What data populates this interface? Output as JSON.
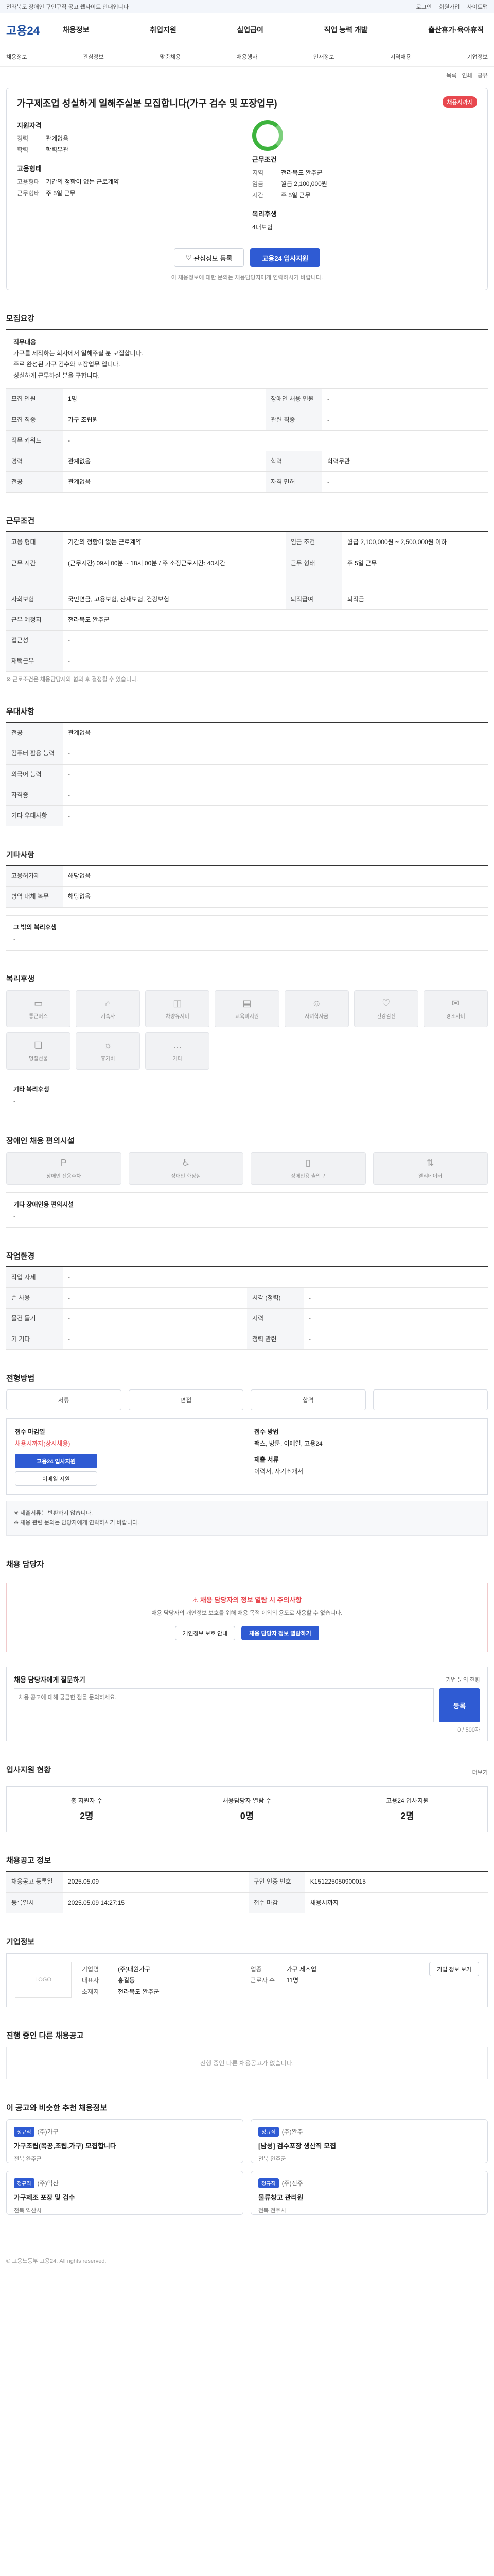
{
  "topbar": {
    "text": "전라북도 장애인 구인구직 공고 웹사이트 안내입니다",
    "links": [
      "로그인",
      "회원가입",
      "사이트맵"
    ]
  },
  "header": {
    "logo": "고용24",
    "nav": [
      "채용정보",
      "취업지원",
      "실업급여",
      "직업 능력 개발",
      "출산휴가·육아휴직"
    ]
  },
  "subnav": [
    "채용정보",
    "관심정보",
    "맞춤채용",
    "채용행사",
    "인재정보",
    "지역채용",
    "기업정보"
  ],
  "util": [
    "목록",
    "인쇄",
    "공유"
  ],
  "job": {
    "title": "가구제조업 성실하게 일해주실분 모집합니다(가구 검수 및 포장업무)",
    "badge": "채용시까지",
    "company_h": "지원자격",
    "company": [
      [
        "경력",
        "관계없음"
      ],
      [
        "학력",
        "학력무관"
      ]
    ],
    "cond_h": "근무조건",
    "cond": [
      [
        "지역",
        "전라북도 완주군"
      ],
      [
        "임금",
        "월급 2,100,000원"
      ],
      [
        "시간",
        "주 5일 근무"
      ]
    ],
    "type_h": "고용형태",
    "type": [
      [
        "고용형태",
        "기간의 정함이 없는 근로계약"
      ],
      [
        "근무형태",
        "주 5일 근무"
      ]
    ],
    "welfare_h": "복리후생",
    "welfare": "4대보험",
    "btn_scrap": "관심정보 등록",
    "btn_apply": "고용24 입사지원",
    "note": "이 채용정보에 대한 문의는 채용담당자에게 연락하시기 바랍니다."
  },
  "recruit": {
    "h": "모집요강",
    "desc": [
      "직무내용",
      "가구를 제작하는 회사에서 일해주실 분 모집합니다.",
      "주로 완성된 가구 검수와 포장업무 입니다.",
      "",
      "성실하게 근무하실 분을 구합니다."
    ],
    "rows": [
      [
        "모집 인원",
        "1명",
        "장애인 채용 인원",
        "-"
      ],
      [
        "모집 직종",
        "가구 조립원",
        "관련 직종",
        "-"
      ],
      [
        "직무 키워드",
        "-",
        "",
        ""
      ],
      [
        "경력",
        "관계없음",
        "학력",
        "학력무관"
      ],
      [
        "전공",
        "관계없음",
        "자격 면허",
        "-"
      ]
    ]
  },
  "work": {
    "h": "근무조건",
    "rows": [
      [
        "고용 형태",
        "기간의 정함이 없는 근로계약",
        "임금 조건",
        "월급 2,100,000원 ~ 2,500,000원 이하"
      ],
      [
        "근무 시간",
        "(근무시간) 09시 00분 ~ 18시 00분 / 주 소정근로시간: 40시간",
        "근무 형태",
        "주 5일 근무"
      ],
      [
        "사회보험",
        "국민연금, 고용보험, 산재보험, 건강보험",
        "퇴직급여",
        "퇴직금"
      ],
      [
        "근무 예정지",
        "전라북도 완주군",
        "",
        ""
      ],
      [
        "접근성",
        "-",
        "",
        ""
      ],
      [
        "재택근무",
        "-",
        "",
        ""
      ]
    ],
    "footnote": "※ 근로조건은 채용담당자와 협의 후 결정될 수 있습니다."
  },
  "special": {
    "h": "우대사항",
    "rows": [
      [
        "전공",
        "관계없음"
      ],
      [
        "컴퓨터 활용 능력",
        "-"
      ],
      [
        "외국어 능력",
        "-"
      ],
      [
        "자격증",
        "-"
      ],
      [
        "기타 우대사항",
        "-"
      ]
    ]
  },
  "etc": {
    "h": "기타사항",
    "rows": [
      [
        "고용허가제",
        "해당없음"
      ],
      [
        "병역 대체 복무",
        "해당없음"
      ]
    ],
    "extra_h": "그 밖의 복리후생",
    "extra": "-"
  },
  "welfare": {
    "h": "복리후생",
    "tiles": [
      "통근버스",
      "기숙사",
      "차량유지비",
      "교육비지원",
      "자녀학자금",
      "건강검진",
      "경조사비",
      "명절선물",
      "휴가비",
      "기타"
    ],
    "extra_h": "기타 복리후생",
    "extra": "-"
  },
  "disability": {
    "h": "장애인 채용 편의시설",
    "tiles": [
      "장애인 전용주차",
      "장애인 화장실",
      "장애인용 출입구",
      "엘리베이터"
    ],
    "extra_h": "기타 장애인용 편의시설",
    "extra": "-"
  },
  "workenv": {
    "h": "작업환경",
    "rows": [
      [
        "작업 자세",
        "-",
        "",
        ""
      ],
      [
        "손 사용",
        "-",
        "시각 (청력)",
        "-"
      ],
      [
        "물건 들기",
        "-",
        "시력",
        "-"
      ],
      [
        "기 기타",
        "-",
        "청력 관련",
        "-"
      ]
    ]
  },
  "process": {
    "h": "전형방법",
    "steps": [
      "서류",
      "면접",
      "합격",
      ""
    ],
    "deadline_h": "접수 마감일",
    "deadline": "채용시까지(상시채용)",
    "btn_apply": "고용24 입사지원",
    "btn_email": "이메일 지원",
    "method_h": "접수 방법",
    "method": "팩스, 방문, 이메일, 고용24",
    "doc_h": "제출 서류",
    "doc": "이력서, 자기소개서",
    "notes": [
      "※ 제출서류는 반환하지 않습니다.",
      "※ 채용 관련 문의는 담당자에게 연락하시기 바랍니다."
    ]
  },
  "contact": {
    "h": "채용 담당자",
    "warn": "채용 담당자의 정보 열람 시 주의사항",
    "warn_text": "채용 담당자의 개인정보 보호를 위해 채용 목적 이외의 용도로 사용할 수 없습니다.",
    "btn1": "개인정보 보호 안내",
    "btn2": "채용 담당자 정보 열람하기"
  },
  "inquiry": {
    "h": "채용 담당자에게 질문하기",
    "link": "기업 문의 현황",
    "placeholder": "채용 공고에 대해 궁금한 점을 문의하세요.",
    "btn": "등록",
    "count": "0 / 500자"
  },
  "applicants": {
    "h": "입사지원 현황",
    "link": "더보기",
    "stats": [
      [
        "총 지원자 수",
        "2명"
      ],
      [
        "채용담당자 열람 수",
        "0명"
      ],
      [
        "고용24 입사지원",
        "2명"
      ]
    ]
  },
  "meta": {
    "h": "채용공고 정보",
    "rows": [
      [
        "채용공고 등록일",
        "2025.05.09",
        "구인 인증 번호",
        "K151225050900015"
      ],
      [
        "등록일시",
        "2025.05.09 14:27:15",
        "접수 마감",
        "채용시까지"
      ]
    ]
  },
  "corp": {
    "h": "기업정보",
    "logo": "LOGO",
    "rows": [
      [
        "기업명",
        "(주)대원가구",
        "업종",
        "가구 제조업"
      ],
      [
        "대표자",
        "홍길동",
        "근로자 수",
        "11명"
      ],
      [
        "소재지",
        "전라북도 완주군",
        "",
        ""
      ]
    ],
    "btn": "기업 정보 보기"
  },
  "others": {
    "h": "진행 중인 다른 채용공고",
    "empty": "진행 중인 다른 채용공고가 없습니다."
  },
  "recommend": {
    "h": "이 공고와 비슷한 추천 채용정보",
    "jobs": [
      {
        "tag": "정규직",
        "co": "(주)가구",
        "title": "가구조립(목공,조립,가구) 모집합니다",
        "meta": "전북 완주군"
      },
      {
        "tag": "정규직",
        "co": "(주)완주",
        "title": "[남성] 검수포장 생산직 모집",
        "meta": "전북 완주군"
      },
      {
        "tag": "정규직",
        "co": "(주)익산",
        "title": "가구제조 포장 및 검수",
        "meta": "전북 익산시"
      },
      {
        "tag": "정규직",
        "co": "(주)전주",
        "title": "물류창고 관리원",
        "meta": "전북 전주시"
      }
    ]
  },
  "footer": "© 고용노동부 고용24. All rights reserved."
}
